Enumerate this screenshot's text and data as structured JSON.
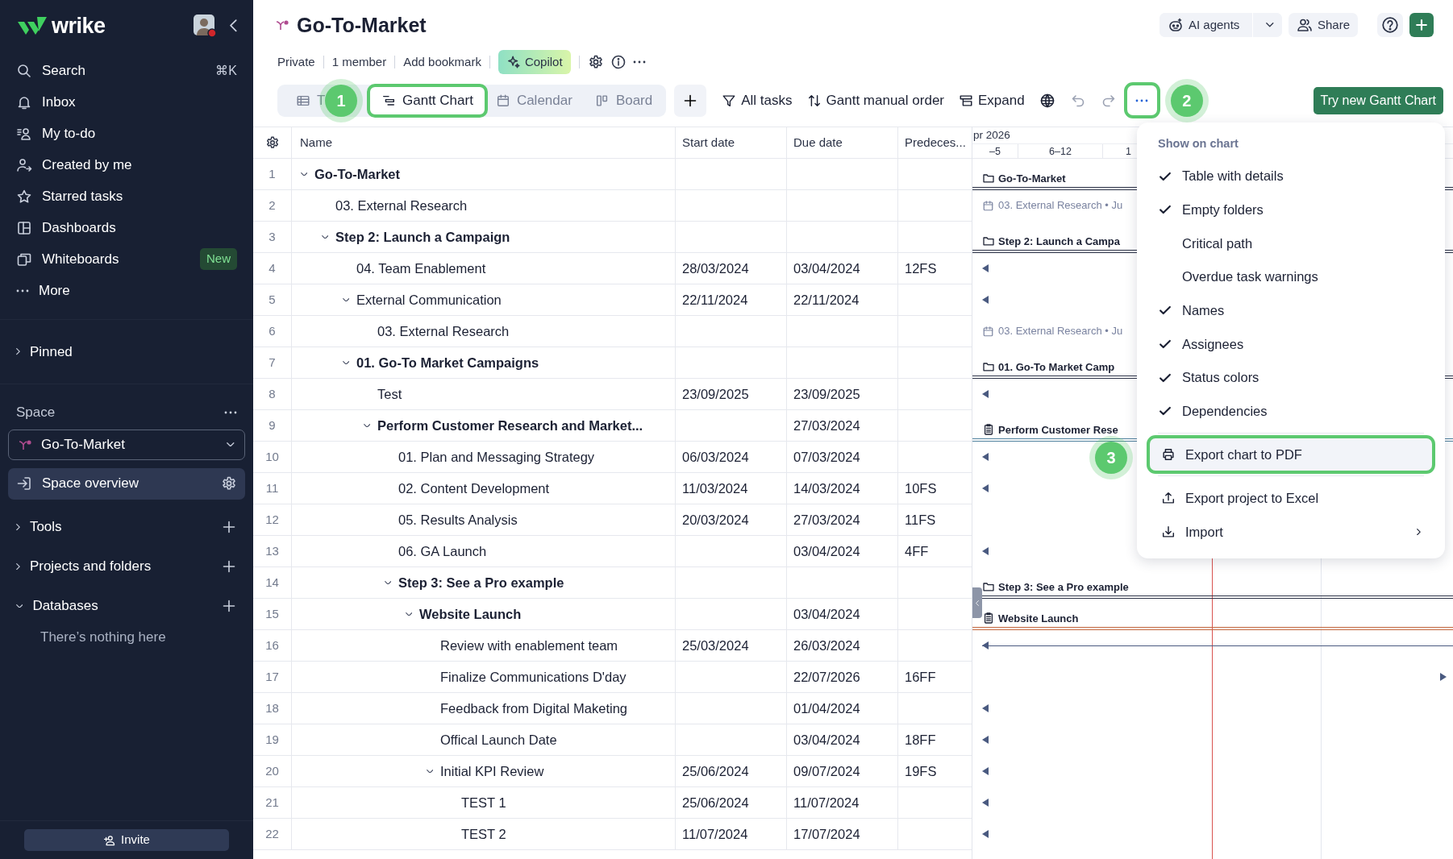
{
  "sidebar": {
    "logo": "wrike",
    "nav": [
      {
        "label": "Search",
        "shortcut": "⌘K"
      },
      {
        "label": "Inbox"
      },
      {
        "label": "My to-do"
      },
      {
        "label": "Created by me"
      },
      {
        "label": "Starred tasks"
      },
      {
        "label": "Dashboards"
      },
      {
        "label": "Whiteboards",
        "badge": "New"
      },
      {
        "label": "More"
      }
    ],
    "pinned": {
      "label": "Pinned",
      "expanded": false
    },
    "space_label": "Space",
    "space_dropdown": "Go-To-Market",
    "overview": {
      "label": "Space overview",
      "selected": true
    },
    "sections": [
      {
        "label": "Tools",
        "expanded": false
      },
      {
        "label": "Projects and folders",
        "expanded": false
      },
      {
        "label": "Databases",
        "expanded": true,
        "empty_text": "There’s nothing here"
      }
    ],
    "invite": "Invite"
  },
  "header": {
    "title": "Go-To-Market",
    "meta": [
      "Private",
      "1 member",
      "Add bookmark"
    ],
    "copilot": "Copilot",
    "ai_agents": "AI agents",
    "share": "Share"
  },
  "tabs": [
    {
      "label": "T",
      "selected": false,
      "highlighted": false,
      "callout": "1"
    },
    {
      "label": "Gantt Chart",
      "selected": true,
      "highlighted": true
    },
    {
      "label": "Calendar",
      "selected": false,
      "highlighted": false
    },
    {
      "label": "Board",
      "selected": false,
      "highlighted": false
    }
  ],
  "toolbar": {
    "filter": "All tasks",
    "order": "Gantt manual order",
    "expand": "Expand",
    "more_highlighted": true,
    "more_callout": "2",
    "try_new": "Try new Gantt Chart"
  },
  "table": {
    "columns": [
      "Name",
      "Start date",
      "Due date",
      "Predeces..."
    ],
    "rows": [
      {
        "num": "1",
        "name": "Go-To-Market",
        "kind": "folder",
        "expanded": true,
        "gantt": {
          "kind": "folder",
          "label": "Go-To-Market"
        },
        "children": [
          {
            "num": "2",
            "name": "03. External Research",
            "kind": "task",
            "gantt": {
              "kind": "ghost",
              "label": "03. External Research • Ju"
            }
          },
          {
            "num": "3",
            "name": "Step 2: Launch a Campaign",
            "kind": "folder",
            "expanded": true,
            "gantt": {
              "kind": "folder",
              "label": "Step 2: Launch a Campa"
            },
            "children": [
              {
                "num": "4",
                "name": "04. Team Enablement",
                "kind": "task",
                "start": "28/03/2024",
                "due": "03/04/2024",
                "pred": "12FS",
                "gantt": {
                  "kind": "arrow_left"
                }
              },
              {
                "num": "5",
                "name": "External Communication",
                "kind": "task",
                "expanded": true,
                "start": "22/11/2024",
                "due": "22/11/2024",
                "gantt": {
                  "kind": "arrow_left"
                },
                "children": [
                  {
                    "num": "6",
                    "name": "03. External Research",
                    "kind": "task",
                    "gantt": {
                      "kind": "ghost",
                      "label": "03. External Research • Ju"
                    }
                  }
                ]
              },
              {
                "num": "7",
                "name": "01. Go-To Market Campaigns",
                "kind": "folder",
                "expanded": true,
                "gantt": {
                  "kind": "folder",
                  "label": "01. Go-To Market Camp"
                },
                "children": [
                  {
                    "num": "8",
                    "name": "Test",
                    "kind": "task",
                    "start": "23/09/2025",
                    "due": "23/09/2025",
                    "gantt": {
                      "kind": "arrow_left"
                    }
                  },
                  {
                    "num": "9",
                    "name": "Perform Customer Research and Market...",
                    "kind": "folder",
                    "expanded": true,
                    "due": "27/03/2024",
                    "gantt": {
                      "kind": "task",
                      "label": "Perform Customer Rese",
                      "color": "#4d7f9c"
                    },
                    "children": [
                      {
                        "num": "10",
                        "name": "01. Plan and Messaging Strategy",
                        "kind": "task",
                        "start": "06/03/2024",
                        "due": "07/03/2024",
                        "gantt": {
                          "kind": "arrow_left"
                        }
                      },
                      {
                        "num": "11",
                        "name": "02. Content Development",
                        "kind": "task",
                        "start": "11/03/2024",
                        "due": "14/03/2024",
                        "pred": "10FS",
                        "gantt": {
                          "kind": "arrow_left"
                        }
                      },
                      {
                        "num": "12",
                        "name": "05. Results Analysis",
                        "kind": "task",
                        "start": "20/03/2024",
                        "due": "27/03/2024",
                        "pred": "11FS"
                      },
                      {
                        "num": "13",
                        "name": "06. GA Launch",
                        "kind": "task",
                        "due": "03/04/2024",
                        "pred": "4FF",
                        "gantt": {
                          "kind": "arrow_left"
                        }
                      },
                      {
                        "num": "14",
                        "name": "Step 3: See a Pro example",
                        "kind": "folder",
                        "expanded": true,
                        "gantt": {
                          "kind": "folder",
                          "label": "Step 3: See a Pro example"
                        },
                        "children": [
                          {
                            "num": "15",
                            "name": "Website Launch",
                            "kind": "folder",
                            "expanded": true,
                            "due": "03/04/2024",
                            "gantt": {
                              "kind": "task",
                              "label": "Website Launch",
                              "color": "#c2673f"
                            },
                            "children": [
                              {
                                "num": "16",
                                "name": "Review with enablement team",
                                "kind": "task",
                                "start": "25/03/2024",
                                "due": "26/03/2024",
                                "gantt": {
                                  "kind": "arrow_left_line"
                                }
                              },
                              {
                                "num": "17",
                                "name": "Finalize Communications D'day",
                                "kind": "task",
                                "due": "22/07/2026",
                                "pred": "16FF",
                                "gantt": {
                                  "kind": "arrow_right"
                                }
                              },
                              {
                                "num": "18",
                                "name": "Feedback from Digital Maketing",
                                "kind": "task",
                                "due": "01/04/2024",
                                "gantt": {
                                  "kind": "arrow_left"
                                }
                              },
                              {
                                "num": "19",
                                "name": "Offical Launch Date",
                                "kind": "task",
                                "due": "03/04/2024",
                                "pred": "18FF",
                                "gantt": {
                                  "kind": "arrow_left"
                                }
                              },
                              {
                                "num": "20",
                                "name": "Initial KPI Review",
                                "kind": "task",
                                "expanded": true,
                                "start": "25/06/2024",
                                "due": "09/07/2024",
                                "pred": "19FS",
                                "gantt": {
                                  "kind": "arrow_left"
                                },
                                "children": [
                                  {
                                    "num": "21",
                                    "name": "TEST 1",
                                    "kind": "task",
                                    "start": "25/06/2024",
                                    "due": "11/07/2024",
                                    "gantt": {
                                      "kind": "arrow_left"
                                    }
                                  },
                                  {
                                    "num": "22",
                                    "name": "TEST 2",
                                    "kind": "task",
                                    "start": "11/07/2024",
                                    "due": "17/07/2024",
                                    "gantt": {
                                      "kind": "arrow_left"
                                    }
                                  }
                                ]
                              }
                            ]
                          }
                        ]
                      }
                    ]
                  }
                ]
              }
            ]
          }
        ]
      }
    ]
  },
  "timeline": {
    "month": "pr 2026",
    "weeks": [
      "–5",
      "6–12",
      "1"
    ]
  },
  "menu": {
    "title": "Show on chart",
    "toggles": [
      {
        "label": "Table with details",
        "checked": true
      },
      {
        "label": "Empty folders",
        "checked": true
      },
      {
        "label": "Critical path",
        "checked": false
      },
      {
        "label": "Overdue task warnings",
        "checked": false
      },
      {
        "label": "Names",
        "checked": true
      },
      {
        "label": "Assignees",
        "checked": true
      },
      {
        "label": "Status colors",
        "checked": true
      },
      {
        "label": "Dependencies",
        "checked": true
      }
    ],
    "actions": [
      {
        "label": "Export chart to PDF",
        "highlighted": true,
        "submenu": false,
        "callout": "3"
      },
      {
        "label": "Export project to Excel",
        "highlighted": false,
        "submenu": false
      },
      {
        "label": "Import",
        "highlighted": false,
        "submenu": true
      }
    ]
  }
}
